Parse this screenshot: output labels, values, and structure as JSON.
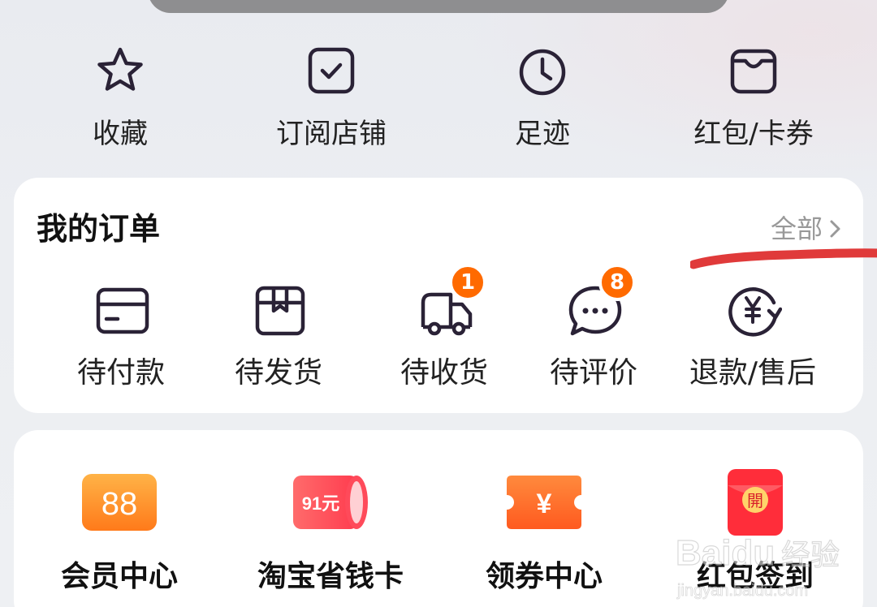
{
  "top_shortcuts": [
    {
      "label": "收藏",
      "icon": "star-icon"
    },
    {
      "label": "订阅店铺",
      "icon": "checkbox-icon"
    },
    {
      "label": "足迹",
      "icon": "clock-icon"
    },
    {
      "label": "红包/卡券",
      "icon": "wallet-icon"
    }
  ],
  "orders": {
    "title": "我的订单",
    "all_label": "全部",
    "items": [
      {
        "label": "待付款",
        "icon": "card-icon",
        "badge": ""
      },
      {
        "label": "待发货",
        "icon": "package-icon",
        "badge": ""
      },
      {
        "label": "待收货",
        "icon": "truck-icon",
        "badge": "1"
      },
      {
        "label": "待评价",
        "icon": "chat-icon",
        "badge": "8"
      },
      {
        "label": "退款/售后",
        "icon": "refund-icon",
        "badge": ""
      }
    ]
  },
  "services": [
    {
      "label": "会员中心",
      "icon_text": "88",
      "icon": "vip-88-icon"
    },
    {
      "label": "淘宝省钱卡",
      "icon_text": "91元",
      "icon": "savings-card-icon"
    },
    {
      "label": "领券中心",
      "icon_text": "¥",
      "icon": "coupon-icon"
    },
    {
      "label": "红包签到",
      "icon_text": "開",
      "icon": "red-envelope-icon"
    }
  ],
  "colors": {
    "accent_orange": "#ff6a00",
    "icon_stroke": "#2a2236",
    "annotation_red": "#e03a3a"
  },
  "watermark": {
    "brand": "Baidu",
    "suffix": "经验",
    "url": "jingyan.baidu.com"
  }
}
